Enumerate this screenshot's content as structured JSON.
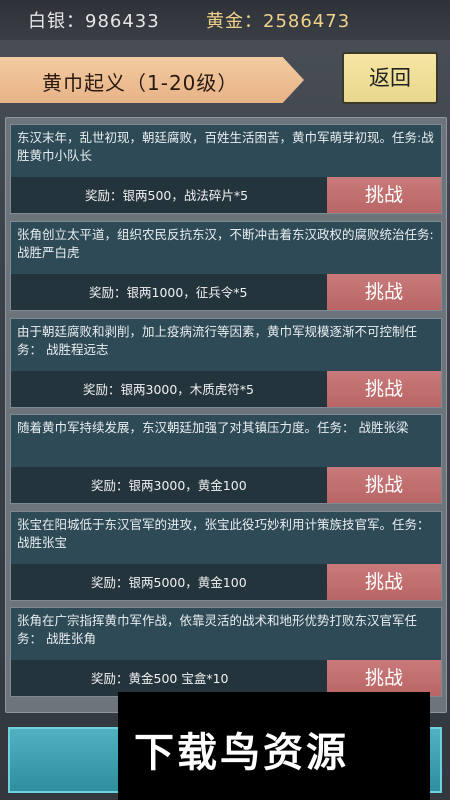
{
  "header": {
    "silver_label": "白银：",
    "silver_value": "986433",
    "gold_label": "黄金：",
    "gold_value": "2586473"
  },
  "title": "黄巾起义（1-20级）",
  "back_label": "返回",
  "quests": [
    {
      "description": "东汉末年，乱世初现，朝廷腐败，百姓生活困苦，黄巾军萌芽初现。任务:战胜黄巾小队长",
      "reward": "奖励：银两500，战法碎片*5",
      "button": "挑战"
    },
    {
      "description": "张角创立太平道，组织农民反抗东汉，不断冲击着东汉政权的腐败统治任务:战胜严白虎",
      "reward": "奖励：银两1000，征兵令*5",
      "button": "挑战"
    },
    {
      "description": "由于朝廷腐败和剥削，加上疫病流行等因素，黄巾军规模逐渐不可控制任务： 战胜程远志",
      "reward": "奖励：银两3000，木质虎符*5",
      "button": "挑战"
    },
    {
      "description": "随着黄巾军持续发展，东汉朝廷加强了对其镇压力度。任务： 战胜张梁",
      "reward": "奖励：银两3000，黄金100",
      "button": "挑战"
    },
    {
      "description": "张宝在阳城低于东汉官军的进攻，张宝此役巧妙利用计策族技官军。任务： 战胜张宝",
      "reward": "奖励：银两5000，黄金100",
      "button": "挑战"
    },
    {
      "description": "张角在广宗指挥黄巾军作战，依靠灵活的战术和地形优势打败东汉官军任务： 战胜张角",
      "reward": "奖励：黄金500 宝盒*10",
      "button": "挑战"
    }
  ],
  "watermark": "下载鸟资源",
  "colors": {
    "banner": "#efc399",
    "back_button": "#f2e19a",
    "card": "#2e4a56",
    "challenge_button": "#c06f6f",
    "gold_text": "#f0d28a"
  }
}
